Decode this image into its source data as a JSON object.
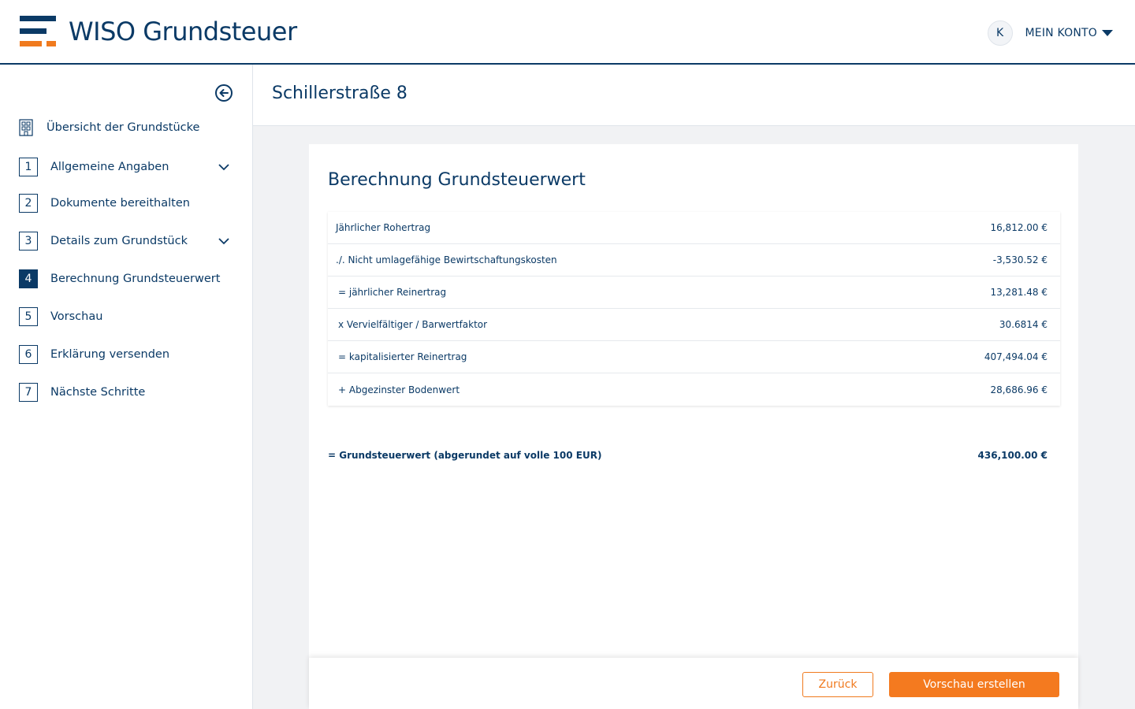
{
  "header": {
    "logo_text": "WISO Grundsteuer",
    "avatar_initial": "K",
    "account_label": "MEIN KONTO"
  },
  "sidebar": {
    "overview_label": "Übersicht der Grundstücke",
    "items": [
      {
        "num": "1",
        "label": "Allgemeine Angaben",
        "expandable": true,
        "active": false
      },
      {
        "num": "2",
        "label": "Dokumente bereithalten",
        "expandable": false,
        "active": false
      },
      {
        "num": "3",
        "label": "Details zum Grundstück",
        "expandable": true,
        "active": false
      },
      {
        "num": "4",
        "label": "Berechnung Grundsteuerwert",
        "expandable": false,
        "active": true
      },
      {
        "num": "5",
        "label": "Vorschau",
        "expandable": false,
        "active": false
      },
      {
        "num": "6",
        "label": "Erklärung versenden",
        "expandable": false,
        "active": false
      },
      {
        "num": "7",
        "label": "Nächste Schritte",
        "expandable": false,
        "active": false
      }
    ]
  },
  "main": {
    "page_title": "Schillerstraße 8",
    "card_title": "Berechnung Grundsteuerwert",
    "rows": [
      {
        "label": "Jährlicher Rohertrag",
        "value": "16,812.00 €"
      },
      {
        "label": "./. Nicht umlagefähige Bewirtschaftungskosten",
        "value": "-3,530.52 €"
      },
      {
        "label": "= jährlicher Reinertrag",
        "value": "13,281.48 €"
      },
      {
        "label": "x Vervielfältiger / Barwertfaktor",
        "value": "30.6814 €"
      },
      {
        "label": "= kapitalisierter Reinertrag",
        "value": "407,494.04 €"
      },
      {
        "label": "+ Abgezinster Bodenwert",
        "value": "28,686.96 €"
      }
    ],
    "total": {
      "label": "= Grundsteuerwert (abgerundet auf volle 100 EUR)",
      "value": "436,100.00 €"
    }
  },
  "footer": {
    "back_label": "Zurück",
    "next_label": "Vorschau erstellen"
  },
  "colors": {
    "primary": "#0b3a66",
    "accent": "#f47a1f"
  }
}
